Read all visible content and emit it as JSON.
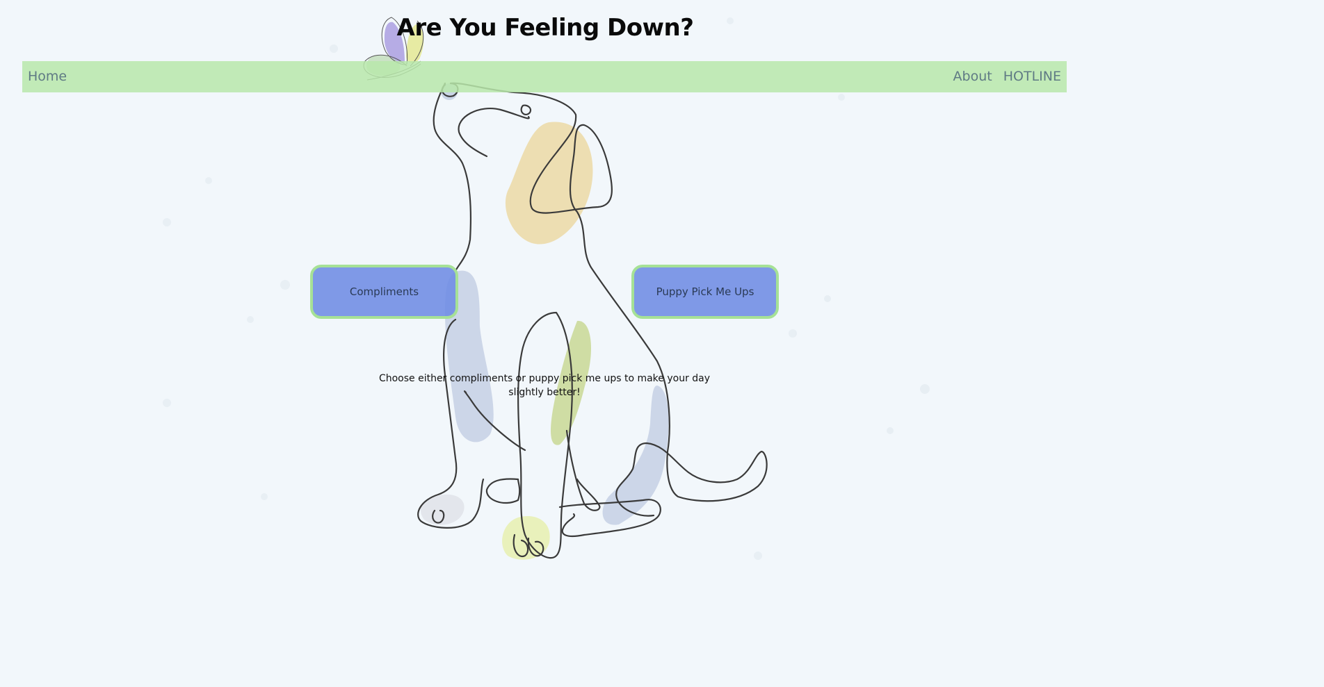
{
  "page": {
    "title": "Are You Feeling Down?"
  },
  "nav": {
    "home": "Home",
    "about": "About",
    "hotline": "HOTLINE"
  },
  "buttons": {
    "compliments": "Compliments",
    "puppy": "Puppy Pick Me Ups"
  },
  "tagline": "Choose either compliments or puppy pick me ups to make your day slightly better!",
  "colors": {
    "background": "#f2f7fb",
    "navbar": "#b8e8aa",
    "button_fill": "#6e8ce4",
    "button_border": "#a6e196",
    "nav_text": "#5f7a84"
  },
  "icons": {
    "butterfly": "butterfly-illustration",
    "dog": "dog-line-art-illustration"
  }
}
